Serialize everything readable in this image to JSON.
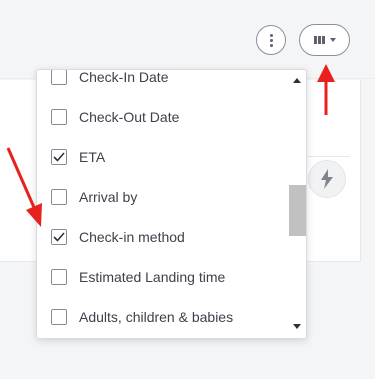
{
  "toolbar": {
    "more_icon": "more-vertical-icon",
    "columns_icon": "columns-icon",
    "caret_icon": "chevron-down-icon"
  },
  "background_action": {
    "icon": "lightning-icon"
  },
  "column_menu": {
    "items": [
      {
        "label": "Check-In Date",
        "checked": false
      },
      {
        "label": "Check-Out Date",
        "checked": false
      },
      {
        "label": "ETA",
        "checked": true
      },
      {
        "label": "Arrival by",
        "checked": false
      },
      {
        "label": "Check-in method",
        "checked": true
      },
      {
        "label": "Estimated Landing time",
        "checked": false
      },
      {
        "label": "Adults, children & babies",
        "checked": false
      }
    ]
  },
  "colors": {
    "annotation_arrow": "#e8201e",
    "scroll_thumb": "#c1c1c1"
  }
}
